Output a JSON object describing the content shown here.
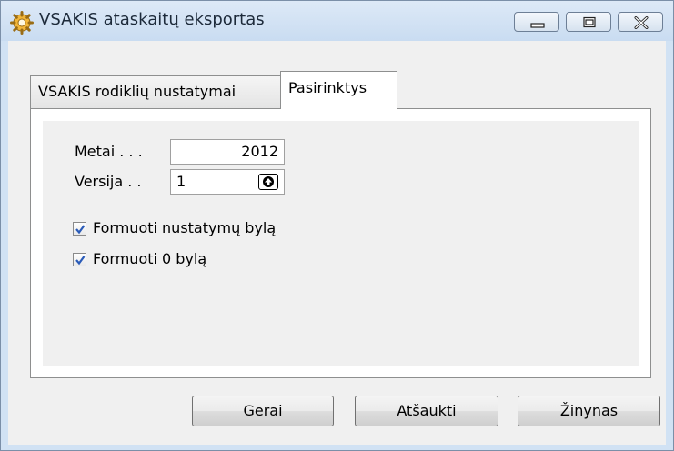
{
  "window": {
    "title": "VSAKIS ataskaitų eksportas",
    "icon": "gears-icon",
    "controls": [
      "minimize-icon",
      "maximize-icon",
      "close-icon"
    ]
  },
  "tabs": [
    {
      "label": "VSAKIS rodiklių nustatymai",
      "active": false
    },
    {
      "label": "Pasirinktys",
      "active": true
    }
  ],
  "form": {
    "year_label": "Metai . . .",
    "year_value": "2012",
    "version_label": "Versija . .",
    "version_value": "1",
    "version_spin_icon": "arrow-up-icon",
    "checkbox1": {
      "label": "Formuoti nustatymų bylą",
      "checked": true
    },
    "checkbox2": {
      "label": "Formuoti 0 bylą",
      "checked": true
    }
  },
  "buttons": {
    "ok": "Gerai",
    "cancel": "Atšaukti",
    "help": "Žinynas"
  },
  "colors": {
    "frame": "#d1e2f4",
    "check": "#2a5bb8"
  }
}
